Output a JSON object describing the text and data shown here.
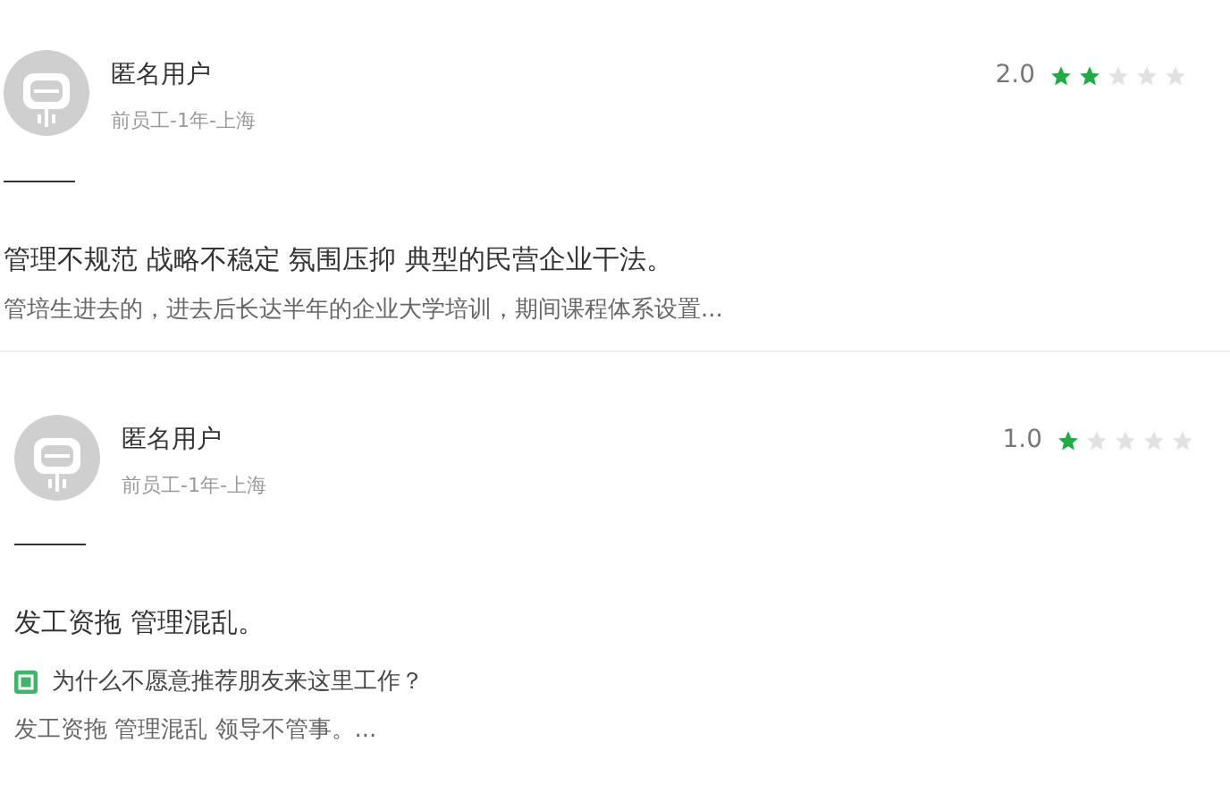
{
  "reviews": [
    {
      "name": "匿名用户",
      "meta": "前员工-1年-上海",
      "rating": "2.0",
      "stars": 2,
      "title": "管理不规范 战略不稳定 氛围压抑 典型的民营企业干法。",
      "sections": [
        {
          "kind": "text",
          "text": "管培生进去的，进去后长达半年的企业大学培训，期间课程体系设置..."
        }
      ]
    },
    {
      "name": "匿名用户",
      "meta": "前员工-1年-上海",
      "rating": "1.0",
      "stars": 1,
      "title": "发工资拖 管理混乱。",
      "sections": [
        {
          "kind": "question",
          "text": "为什么不愿意推荐朋友来这里工作？"
        },
        {
          "kind": "text",
          "text": "发工资拖 管理混乱 领导不管事。..."
        }
      ]
    }
  ]
}
